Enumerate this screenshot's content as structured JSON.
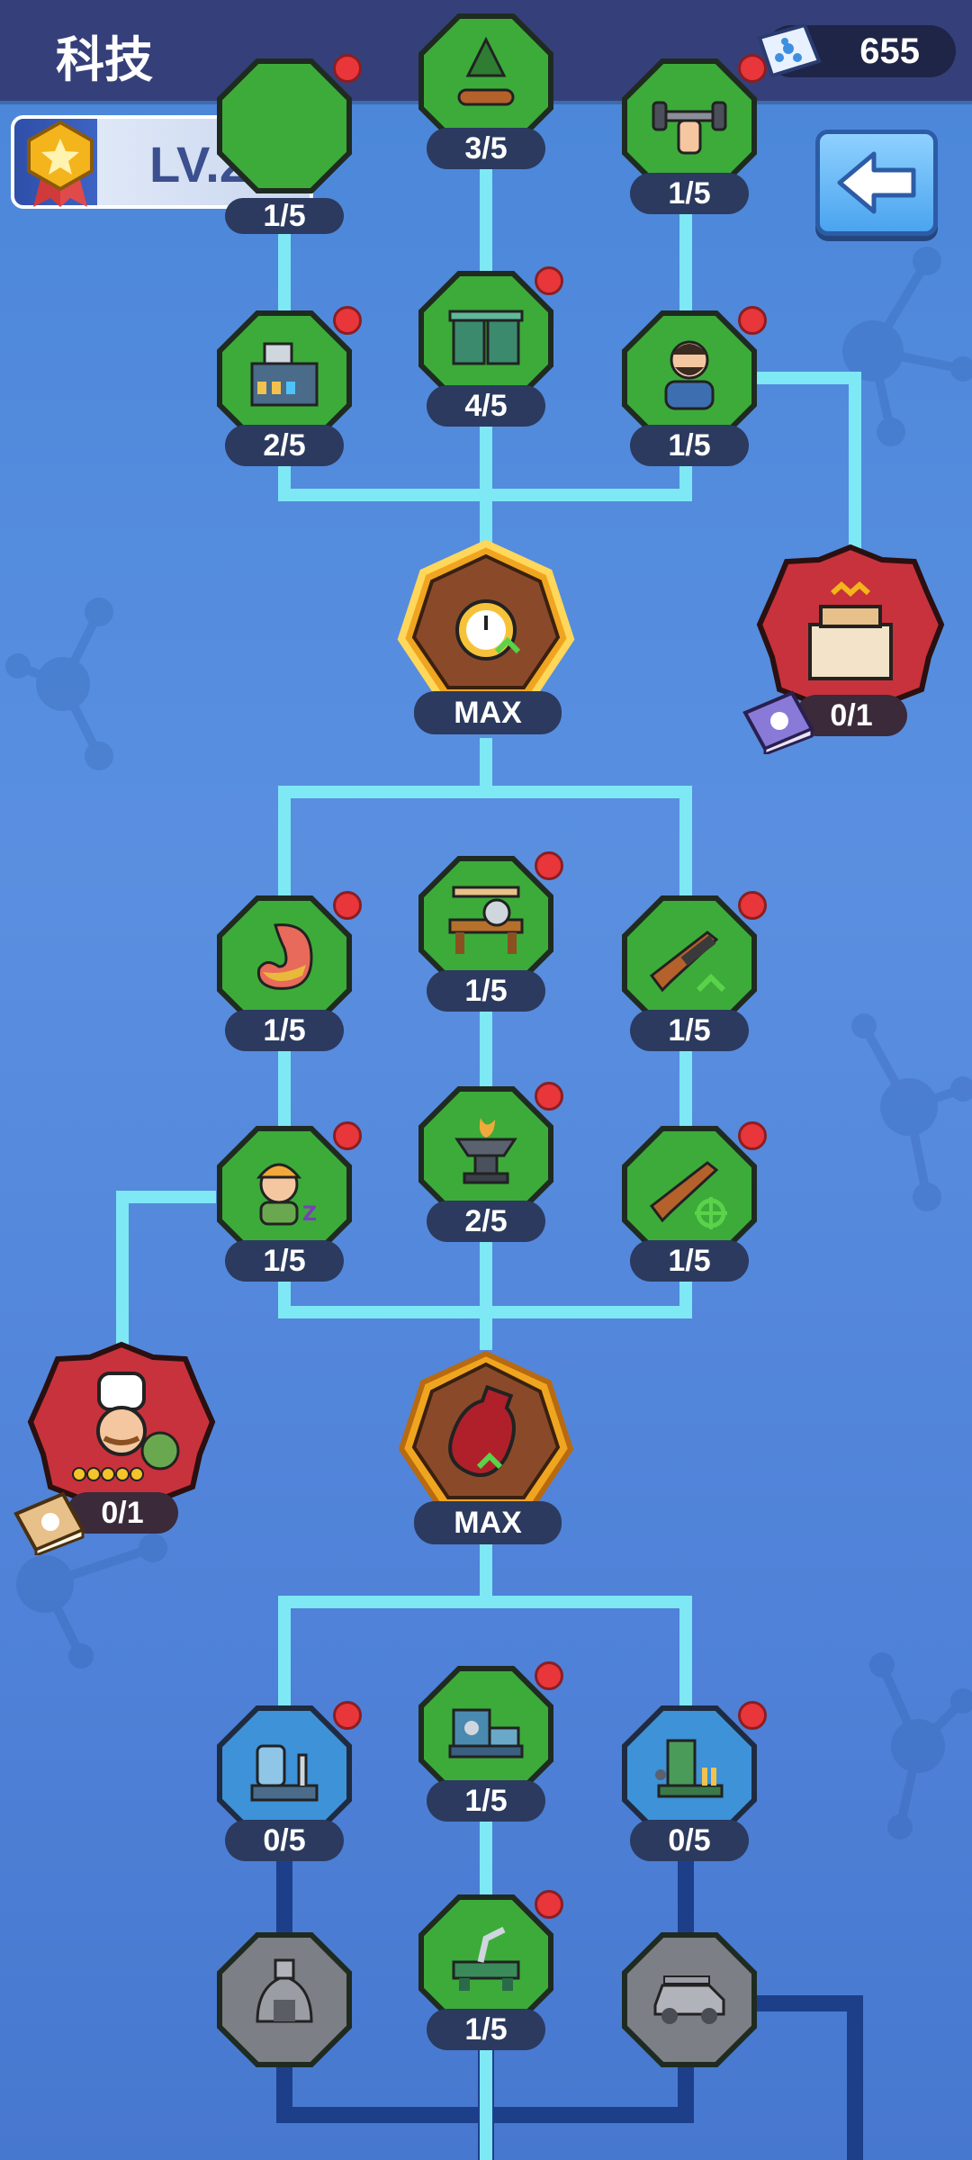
{
  "header": {
    "title": "科技",
    "currency_value": "655"
  },
  "player": {
    "level": "LV.28"
  },
  "nodes": {
    "row0": [
      {
        "label": "1/5"
      },
      {
        "label": "3/5"
      },
      {
        "label": "1/5"
      }
    ],
    "row1": [
      {
        "label": "2/5"
      },
      {
        "label": "4/5"
      },
      {
        "label": "1/5"
      }
    ],
    "row2": [
      {
        "label": "1/5"
      },
      {
        "label": "1/5"
      },
      {
        "label": "1/5"
      }
    ],
    "row3": [
      {
        "label": "1/5"
      },
      {
        "label": "2/5"
      },
      {
        "label": "1/5"
      }
    ],
    "row4": [
      {
        "label": "0/5"
      },
      {
        "label": "1/5"
      },
      {
        "label": "0/5"
      }
    ],
    "row5": [
      {
        "label": "1/5"
      }
    ]
  },
  "milestones": [
    {
      "label": "MAX"
    },
    {
      "label": "MAX"
    }
  ],
  "specials": [
    {
      "label": "0/1"
    },
    {
      "label": "0/1"
    }
  ],
  "colors": {
    "unlocked": "#3cab3a",
    "available": "#3d92d8",
    "locked": "#7c7f86",
    "milestone": "#8a4a2a",
    "special": "#c8323c"
  }
}
